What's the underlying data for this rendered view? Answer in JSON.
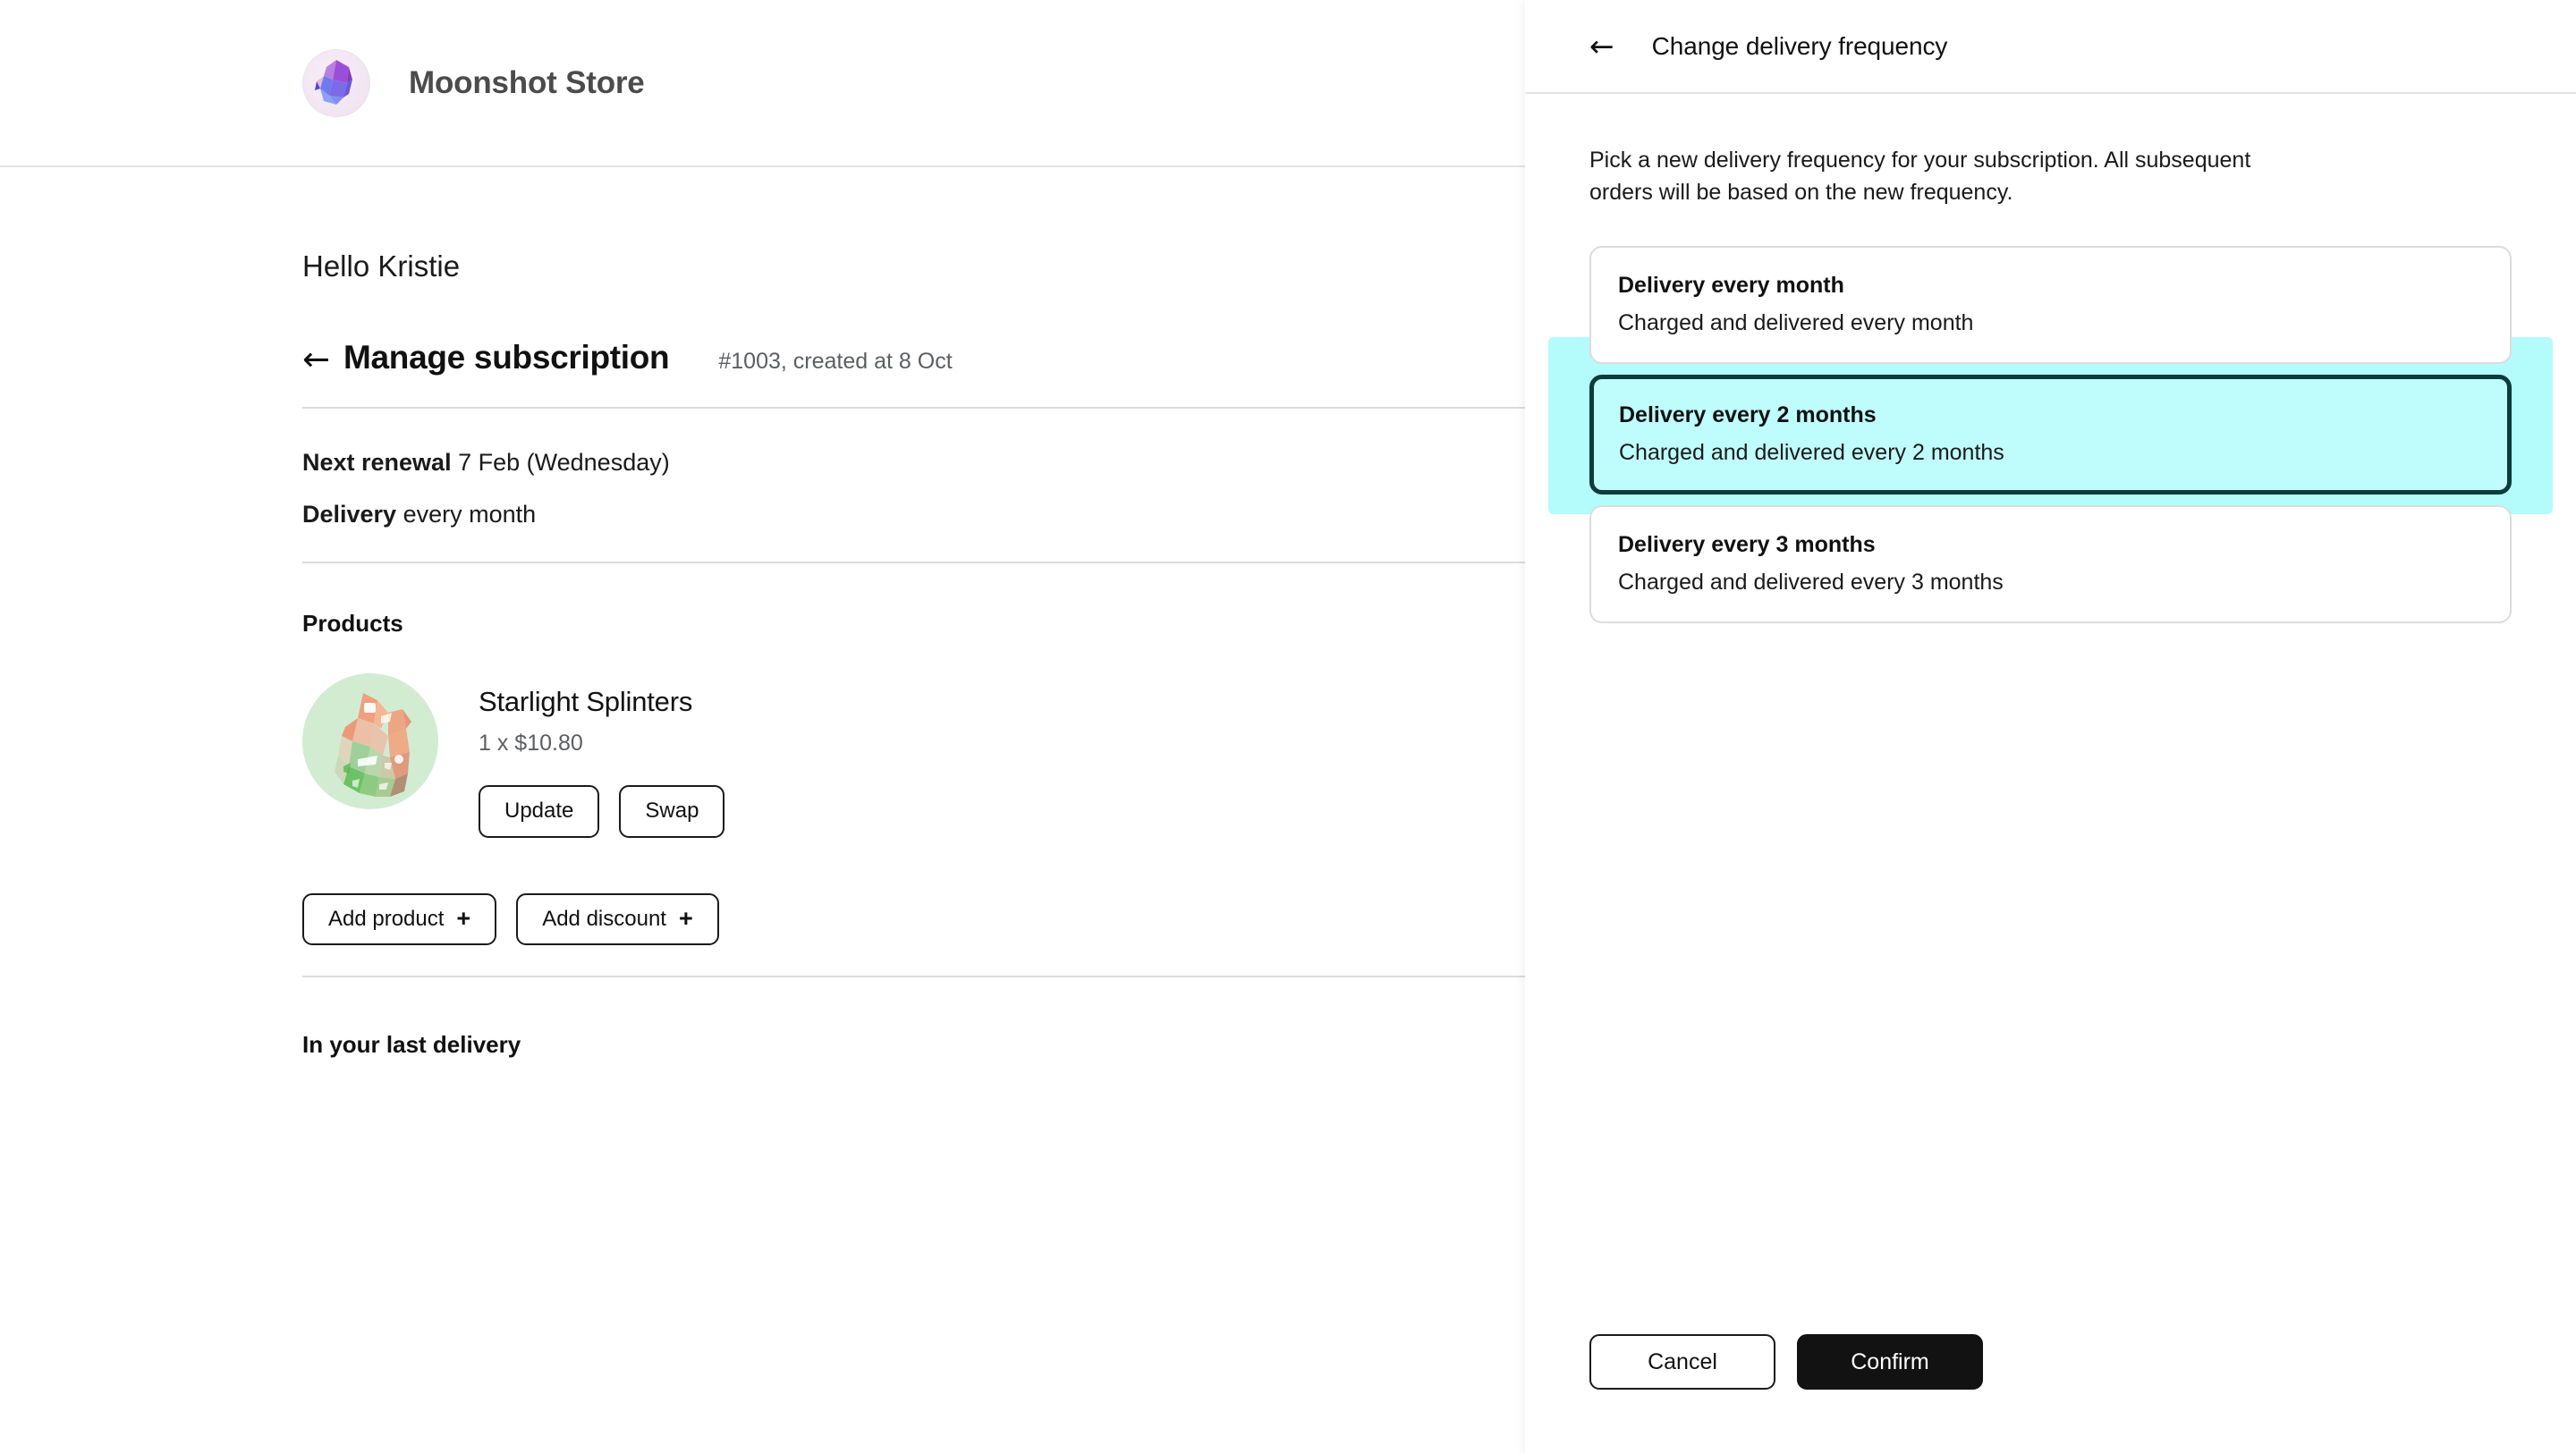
{
  "store": {
    "name": "Moonshot Store",
    "logo_icon": "gem-logo-icon"
  },
  "main": {
    "greeting": "Hello Kristie",
    "back_icon": "back-arrow-icon",
    "page_title": "Manage subscription",
    "page_meta": "#1003, created at 8 Oct",
    "facts": [
      {
        "label": "Next renewal",
        "value": "7 Feb (Wednesday)"
      },
      {
        "label": "Delivery",
        "value": "every month"
      }
    ],
    "products_heading": "Products",
    "product": {
      "name": "Starlight Splinters",
      "price_line": "1 x $10.80",
      "image_alt": "abstract-crystal-product-image",
      "update_label": "Update",
      "swap_label": "Swap"
    },
    "add_product_label": "Add product",
    "add_discount_label": "Add discount",
    "plus_icon": "plus-icon",
    "last_delivery_heading": "In your last delivery"
  },
  "panel": {
    "back_icon": "back-arrow-icon",
    "title": "Change delivery frequency",
    "description": "Pick a new delivery frequency for your subscription. All subsequent orders will be based on the new frequency.",
    "options": [
      {
        "title": "Delivery every month",
        "subtitle": "Charged and delivered every month",
        "selected": false
      },
      {
        "title": "Delivery every 2 months",
        "subtitle": "Charged and delivered every 2 months",
        "selected": true
      },
      {
        "title": "Delivery every 3 months",
        "subtitle": "Charged and delivered every 3 months",
        "selected": false
      }
    ],
    "cancel_label": "Cancel",
    "confirm_label": "Confirm"
  },
  "colors": {
    "highlight_cyan": "#b4fbfb",
    "selected_border": "#0e3b3b",
    "confirm_bg": "#121212",
    "border_gray": "#dcdcdc",
    "muted_text": "#5c5f62"
  }
}
